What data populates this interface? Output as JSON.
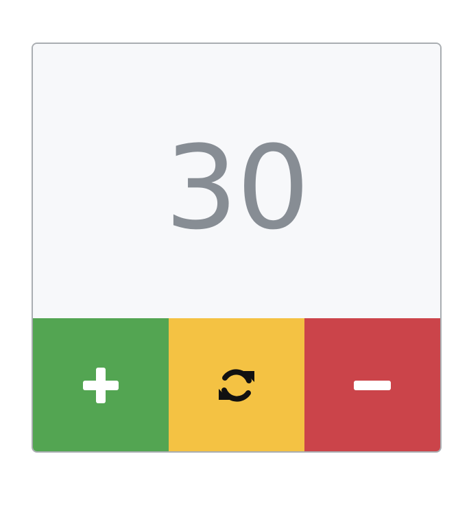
{
  "counter": {
    "value": "30"
  },
  "buttons": {
    "increment": {
      "icon": "plus-icon",
      "color": "#53a552"
    },
    "reset": {
      "icon": "refresh-icon",
      "color": "#f4c243"
    },
    "decrement": {
      "icon": "minus-icon",
      "color": "#cb444a"
    }
  },
  "colors": {
    "card_background": "#f7f8fa",
    "card_border": "#a9adb1",
    "value_text": "#878d94"
  }
}
